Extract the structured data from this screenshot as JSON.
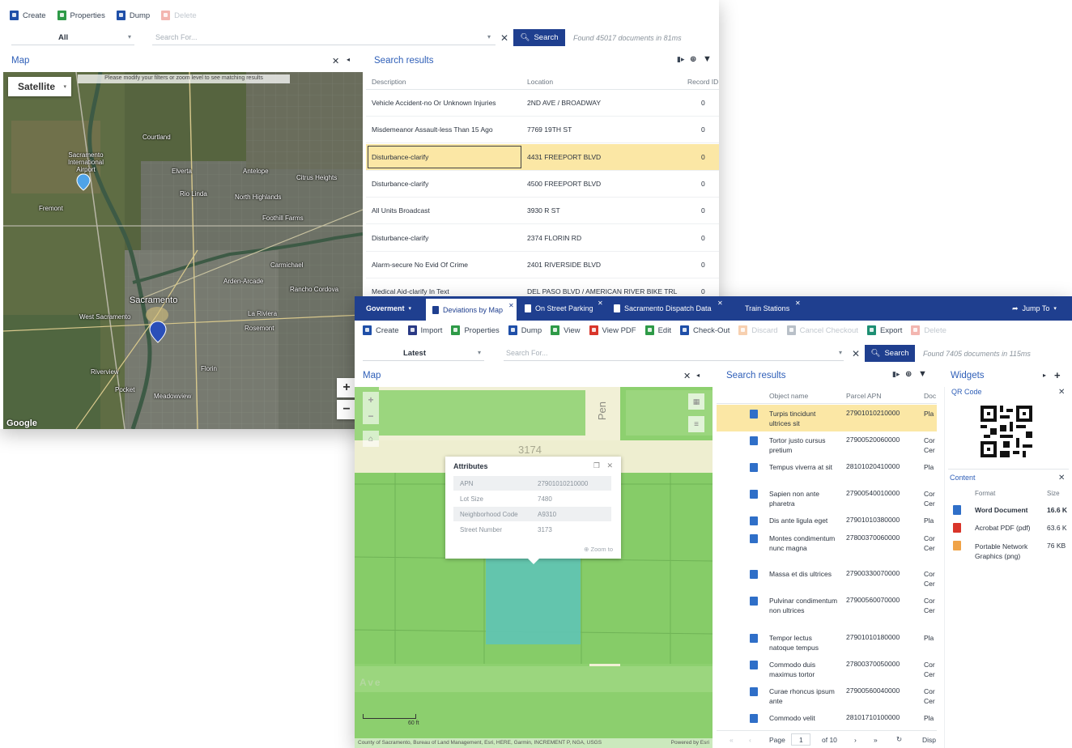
{
  "window1": {
    "toolbar": {
      "create": "Create",
      "properties": "Properties",
      "dump": "Dump",
      "delete": "Delete"
    },
    "filter": {
      "scope": "All",
      "search_placeholder": "Search For...",
      "search_button": "Search",
      "found": "Found 45017 documents in 81ms"
    },
    "map": {
      "title": "Map",
      "layer": "Satellite",
      "banner": "Please modify your filters or zoom level to see matching results",
      "attribution": "Google",
      "places": [
        {
          "name": "Sacramento International Airport"
        },
        {
          "name": "Sacramento"
        },
        {
          "name": "Elverta"
        },
        {
          "name": "Antelope"
        },
        {
          "name": "Citrus Heights"
        },
        {
          "name": "Rio Linda"
        },
        {
          "name": "North Highlands"
        },
        {
          "name": "Fremont"
        },
        {
          "name": "Foothill Farms"
        },
        {
          "name": "Carmichael"
        },
        {
          "name": "Arden-Arcade"
        },
        {
          "name": "Rancho Cordova"
        },
        {
          "name": "West Sacramento"
        },
        {
          "name": "La Riviera"
        },
        {
          "name": "Rosemont"
        },
        {
          "name": "Riverview"
        },
        {
          "name": "Pocket"
        },
        {
          "name": "Meadowview"
        },
        {
          "name": "Florin"
        },
        {
          "name": "Courtland"
        }
      ]
    },
    "results": {
      "title": "Search results",
      "columns": [
        "Description",
        "Location",
        "Record ID"
      ],
      "rows": [
        {
          "description": "Vehicle Accident-no Or Unknown Injuries",
          "location": "2ND AVE / BROADWAY",
          "record_id": "0"
        },
        {
          "description": "Misdemeanor Assault-less Than 15 Ago",
          "location": "7769 19TH ST",
          "record_id": "0"
        },
        {
          "description": "Disturbance-clarify",
          "location": "4431 FREEPORT BLVD",
          "record_id": "0"
        },
        {
          "description": "Disturbance-clarify",
          "location": "4500 FREEPORT BLVD",
          "record_id": "0"
        },
        {
          "description": "All Units Broadcast",
          "location": "3930 R ST",
          "record_id": "0"
        },
        {
          "description": "Disturbance-clarify",
          "location": "2374 FLORIN RD",
          "record_id": "0"
        },
        {
          "description": "Alarm-secure No Evid Of Crime",
          "location": "2401 RIVERSIDE BLVD",
          "record_id": "0"
        },
        {
          "description": "Medical Aid-clarify In Text",
          "location": "DEL PASO BLVD / AMERICAN RIVER BIKE TRL",
          "record_id": "0"
        }
      ]
    }
  },
  "window2": {
    "tabs": {
      "menu": "Goverment",
      "items": [
        "Deviations by Map",
        "On Street Parking",
        "Sacramento Dispatch Data",
        "Train Stations"
      ],
      "jump_to": "Jump To"
    },
    "toolbar": {
      "create": "Create",
      "import": "Import",
      "properties": "Properties",
      "dump": "Dump",
      "view": "View",
      "view_pdf": "View PDF",
      "edit": "Edit",
      "check_out": "Check-Out",
      "discard": "Discard",
      "cancel_checkout": "Cancel Checkout",
      "export": "Export",
      "delete": "Delete"
    },
    "filter": {
      "scope": "Latest",
      "search_placeholder": "Search For...",
      "search_button": "Search",
      "found": "Found 7405 documents in 115ms"
    },
    "map": {
      "title": "Map",
      "street_pen": "Pen",
      "lot_number": "3174",
      "street_ave": "Ave",
      "scale": "60 ft",
      "attribution_left": "County of Sacramento, Bureau of Land Management, Esri, HERE, Garmin, INCREMENT P, NGA, USGS",
      "attribution_right": "Powered by Esri",
      "popup": {
        "title": "Attributes",
        "rows": [
          {
            "key": "APN",
            "value": "27901010210000"
          },
          {
            "key": "Lot Size",
            "value": "7480"
          },
          {
            "key": "Neighborhood Code",
            "value": "A9310"
          },
          {
            "key": "Street Number",
            "value": "3173"
          }
        ],
        "zoom_to": "Zoom to"
      }
    },
    "results": {
      "title": "Search results",
      "columns": [
        "Object name",
        "Parcel APN",
        "Doc"
      ],
      "rows": [
        {
          "name": "Turpis tincidunt ultrices sit",
          "apn": "27901010210000",
          "doc": "Pla"
        },
        {
          "name": "Tortor justo cursus pretium",
          "apn": "27900520060000",
          "doc": "Cor Cer"
        },
        {
          "name": "Tempus viverra at sit",
          "apn": "28101020410000",
          "doc": "Pla"
        },
        {
          "name": "Sapien non ante pharetra",
          "apn": "27900540010000",
          "doc": "Cor Cer"
        },
        {
          "name": "Dis ante ligula eget",
          "apn": "27901010380000",
          "doc": "Pla"
        },
        {
          "name": "Montes condimentum nunc magna",
          "apn": "27800370060000",
          "doc": "Cor Cer"
        },
        {
          "name": "Massa et dis ultrices",
          "apn": "27900330070000",
          "doc": "Cor Cer"
        },
        {
          "name": "Pulvinar condimentum non ultrices",
          "apn": "27900560070000",
          "doc": "Cor Cer"
        },
        {
          "name": "Tempor lectus natoque tempus",
          "apn": "27901010180000",
          "doc": "Pla"
        },
        {
          "name": "Commodo duis maximus tortor",
          "apn": "27800370050000",
          "doc": "Cor Cer"
        },
        {
          "name": "Curae rhoncus ipsum ante",
          "apn": "27900560040000",
          "doc": "Cor Cer"
        },
        {
          "name": "Commodo velit",
          "apn": "28101710100000",
          "doc": "Pla"
        }
      ],
      "pager": {
        "page_label": "Page",
        "page": "1",
        "of": "of 10",
        "display": "Disp"
      }
    },
    "widgets": {
      "title": "Widgets",
      "qr_title": "QR Code",
      "content_title": "Content",
      "content_columns": [
        "Format",
        "Size"
      ],
      "content_rows": [
        {
          "format": "Word Document",
          "size": "16.6 K",
          "icon": "word-icon"
        },
        {
          "format": "Acrobat PDF (pdf)",
          "size": "63.6 K",
          "icon": "pdf-icon"
        },
        {
          "format": "Portable Network Graphics (png)",
          "size": "76 KB",
          "icon": "png-icon"
        }
      ]
    }
  },
  "colors": {
    "brand_navy": "#1f3f8f",
    "panel_title_blue": "#2f5fb8",
    "selected_row": "#fbe7a5",
    "parcel_highlight": "#5fc4b5"
  }
}
